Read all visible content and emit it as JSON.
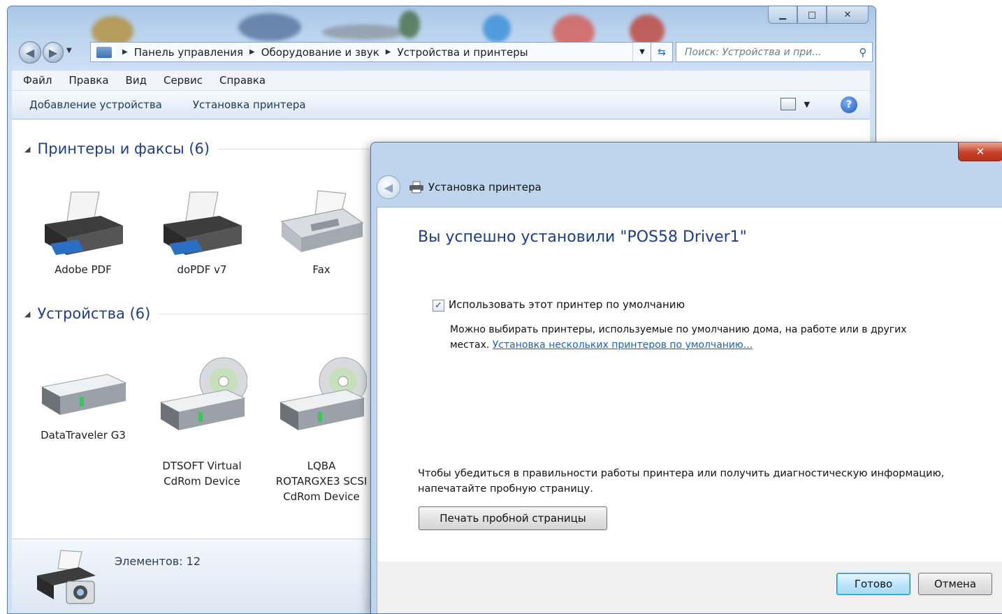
{
  "window": {
    "minimize": "▁",
    "maximize": "□",
    "close": "✕"
  },
  "address": {
    "segments": [
      "Панель управления",
      "Оборудование и звук",
      "Устройства и принтеры"
    ],
    "search_placeholder": "Поиск: Устройства и при..."
  },
  "menu": [
    "Файл",
    "Правка",
    "Вид",
    "Сервис",
    "Справка"
  ],
  "commands": [
    "Добавление устройства",
    "Установка принтера"
  ],
  "groups": {
    "printers": {
      "title": "Принтеры и факсы (6)",
      "items": [
        "Adobe PDF",
        "doPDF v7",
        "Fax"
      ]
    },
    "devices": {
      "title": "Устройства (6)",
      "items": [
        "DataTraveler G3",
        "DTSOFT Virtual\nCdRom Device",
        "LQBA\nROTARGXE3 SCSI\nCdRom Device"
      ]
    }
  },
  "details": {
    "count": "Элементов: 12"
  },
  "dialog": {
    "title": "Установка принтера",
    "close": "✕",
    "heading": "Вы успешно установили \"POS58 Driver1\"",
    "default_checkbox_label": "Использовать этот принтер по умолчанию",
    "default_checked": true,
    "note_text": "Можно выбирать принтеры, используемые по умолчанию дома, на работе или в других местах.",
    "note_link": "Установка нескольких принтеров по умолчанию...",
    "diag_text": "Чтобы убедиться в правильности работы принтера или получить диагностическую информацию, напечатайте пробную страницу.",
    "print_test_button": "Печать пробной страницы",
    "ok_button": "Готово",
    "cancel_button": "Отмена"
  },
  "colors": {
    "heading_blue": "#1a3e8f",
    "link_blue": "#1a62c7",
    "close_red": "#c7412a"
  }
}
